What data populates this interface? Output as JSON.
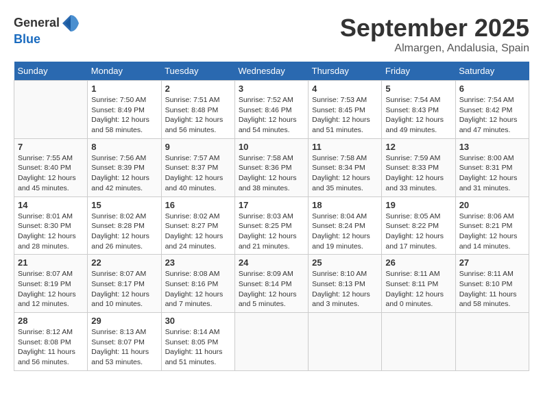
{
  "logo": {
    "line1": "General",
    "line2": "Blue"
  },
  "title": "September 2025",
  "location": "Almargen, Andalusia, Spain",
  "weekdays": [
    "Sunday",
    "Monday",
    "Tuesday",
    "Wednesday",
    "Thursday",
    "Friday",
    "Saturday"
  ],
  "weeks": [
    [
      {
        "day": "",
        "info": ""
      },
      {
        "day": "1",
        "info": "Sunrise: 7:50 AM\nSunset: 8:49 PM\nDaylight: 12 hours\nand 58 minutes."
      },
      {
        "day": "2",
        "info": "Sunrise: 7:51 AM\nSunset: 8:48 PM\nDaylight: 12 hours\nand 56 minutes."
      },
      {
        "day": "3",
        "info": "Sunrise: 7:52 AM\nSunset: 8:46 PM\nDaylight: 12 hours\nand 54 minutes."
      },
      {
        "day": "4",
        "info": "Sunrise: 7:53 AM\nSunset: 8:45 PM\nDaylight: 12 hours\nand 51 minutes."
      },
      {
        "day": "5",
        "info": "Sunrise: 7:54 AM\nSunset: 8:43 PM\nDaylight: 12 hours\nand 49 minutes."
      },
      {
        "day": "6",
        "info": "Sunrise: 7:54 AM\nSunset: 8:42 PM\nDaylight: 12 hours\nand 47 minutes."
      }
    ],
    [
      {
        "day": "7",
        "info": "Sunrise: 7:55 AM\nSunset: 8:40 PM\nDaylight: 12 hours\nand 45 minutes."
      },
      {
        "day": "8",
        "info": "Sunrise: 7:56 AM\nSunset: 8:39 PM\nDaylight: 12 hours\nand 42 minutes."
      },
      {
        "day": "9",
        "info": "Sunrise: 7:57 AM\nSunset: 8:37 PM\nDaylight: 12 hours\nand 40 minutes."
      },
      {
        "day": "10",
        "info": "Sunrise: 7:58 AM\nSunset: 8:36 PM\nDaylight: 12 hours\nand 38 minutes."
      },
      {
        "day": "11",
        "info": "Sunrise: 7:58 AM\nSunset: 8:34 PM\nDaylight: 12 hours\nand 35 minutes."
      },
      {
        "day": "12",
        "info": "Sunrise: 7:59 AM\nSunset: 8:33 PM\nDaylight: 12 hours\nand 33 minutes."
      },
      {
        "day": "13",
        "info": "Sunrise: 8:00 AM\nSunset: 8:31 PM\nDaylight: 12 hours\nand 31 minutes."
      }
    ],
    [
      {
        "day": "14",
        "info": "Sunrise: 8:01 AM\nSunset: 8:30 PM\nDaylight: 12 hours\nand 28 minutes."
      },
      {
        "day": "15",
        "info": "Sunrise: 8:02 AM\nSunset: 8:28 PM\nDaylight: 12 hours\nand 26 minutes."
      },
      {
        "day": "16",
        "info": "Sunrise: 8:02 AM\nSunset: 8:27 PM\nDaylight: 12 hours\nand 24 minutes."
      },
      {
        "day": "17",
        "info": "Sunrise: 8:03 AM\nSunset: 8:25 PM\nDaylight: 12 hours\nand 21 minutes."
      },
      {
        "day": "18",
        "info": "Sunrise: 8:04 AM\nSunset: 8:24 PM\nDaylight: 12 hours\nand 19 minutes."
      },
      {
        "day": "19",
        "info": "Sunrise: 8:05 AM\nSunset: 8:22 PM\nDaylight: 12 hours\nand 17 minutes."
      },
      {
        "day": "20",
        "info": "Sunrise: 8:06 AM\nSunset: 8:21 PM\nDaylight: 12 hours\nand 14 minutes."
      }
    ],
    [
      {
        "day": "21",
        "info": "Sunrise: 8:07 AM\nSunset: 8:19 PM\nDaylight: 12 hours\nand 12 minutes."
      },
      {
        "day": "22",
        "info": "Sunrise: 8:07 AM\nSunset: 8:17 PM\nDaylight: 12 hours\nand 10 minutes."
      },
      {
        "day": "23",
        "info": "Sunrise: 8:08 AM\nSunset: 8:16 PM\nDaylight: 12 hours\nand 7 minutes."
      },
      {
        "day": "24",
        "info": "Sunrise: 8:09 AM\nSunset: 8:14 PM\nDaylight: 12 hours\nand 5 minutes."
      },
      {
        "day": "25",
        "info": "Sunrise: 8:10 AM\nSunset: 8:13 PM\nDaylight: 12 hours\nand 3 minutes."
      },
      {
        "day": "26",
        "info": "Sunrise: 8:11 AM\nSunset: 8:11 PM\nDaylight: 12 hours\nand 0 minutes."
      },
      {
        "day": "27",
        "info": "Sunrise: 8:11 AM\nSunset: 8:10 PM\nDaylight: 11 hours\nand 58 minutes."
      }
    ],
    [
      {
        "day": "28",
        "info": "Sunrise: 8:12 AM\nSunset: 8:08 PM\nDaylight: 11 hours\nand 56 minutes."
      },
      {
        "day": "29",
        "info": "Sunrise: 8:13 AM\nSunset: 8:07 PM\nDaylight: 11 hours\nand 53 minutes."
      },
      {
        "day": "30",
        "info": "Sunrise: 8:14 AM\nSunset: 8:05 PM\nDaylight: 11 hours\nand 51 minutes."
      },
      {
        "day": "",
        "info": ""
      },
      {
        "day": "",
        "info": ""
      },
      {
        "day": "",
        "info": ""
      },
      {
        "day": "",
        "info": ""
      }
    ]
  ]
}
